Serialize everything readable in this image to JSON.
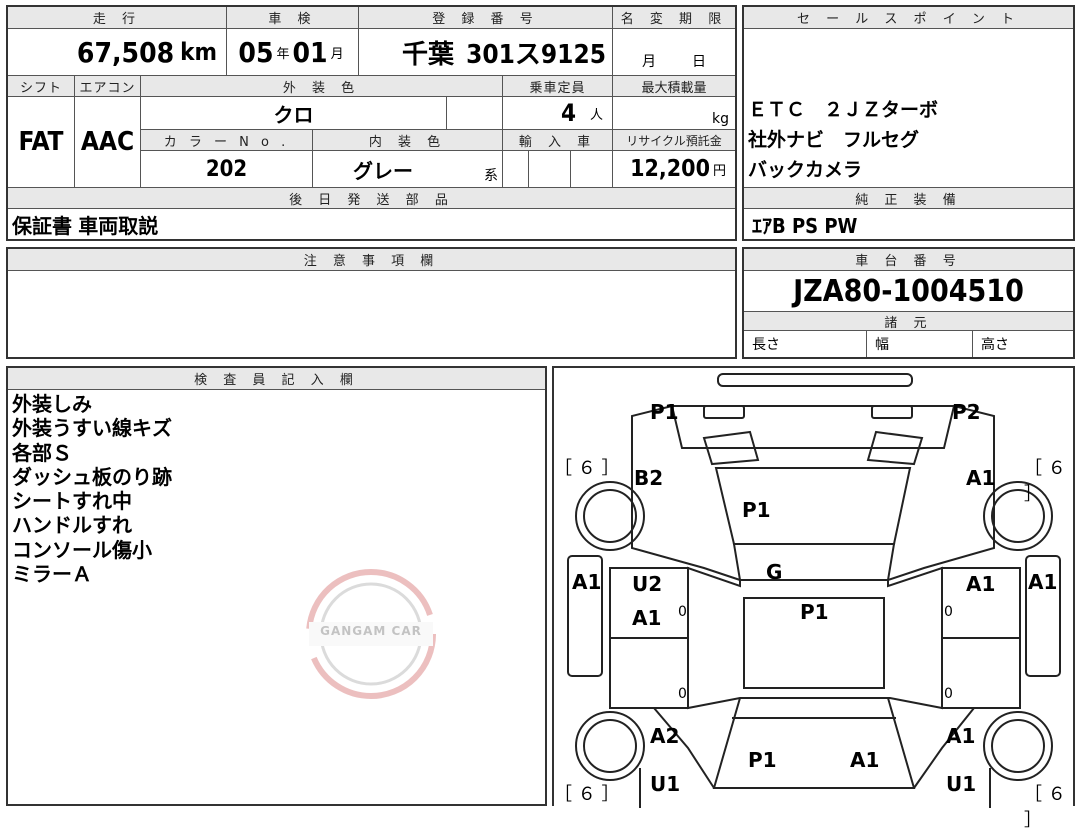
{
  "header": {
    "mileage_label": "走 行",
    "inspection_label": "車 検",
    "reg_label": "登 録 番 号",
    "name_change_label": "名 変 期 限",
    "sales_label": "セ ー ル ス ポ イ ン ト"
  },
  "row1": {
    "mileage": "67,508",
    "mileage_unit": "km",
    "inspection_year": "05",
    "year_unit": "年",
    "inspection_month": "01",
    "month_unit": "月",
    "reg_area": "千葉",
    "reg_number": "301ス9125",
    "name_month": "月",
    "name_day": "日"
  },
  "row2_labels": {
    "shift": "シフト",
    "aircon": "エアコン",
    "exterior_color": "外 装 色",
    "capacity": "乗車定員",
    "max_load": "最大積載量"
  },
  "row2": {
    "shift": "FAT",
    "aircon": "AAC",
    "exterior_color": "クロ",
    "capacity": "4",
    "capacity_unit": "人",
    "load_unit": "kg"
  },
  "row3_labels": {
    "color_no": "カ ラ ー N o .",
    "interior_color": "内 装 色",
    "import": "輸 入 車",
    "recycle": "リサイクル預託金"
  },
  "row3": {
    "color_no": "202",
    "interior_color": "グレー",
    "interior_suffix": "系",
    "recycle": "12,200",
    "recycle_unit": "円"
  },
  "sales_points": [
    "ＥＴＣ　２ＪＺターボ",
    "社外ナビ　フルセグ",
    "バックカメラ"
  ],
  "later_parts": {
    "label": "後 日 発 送 部 品",
    "value": "保証書 車両取説"
  },
  "genuine_equipment": {
    "label": "純 正 装 備",
    "value": "ｴｱB PS PW"
  },
  "notes": {
    "label": "注 意 事 項 欄"
  },
  "chassis": {
    "label": "車 台 番 号",
    "value": "JZA80-1004510",
    "spec_label": "諸 元",
    "length": "長さ",
    "width": "幅",
    "height": "高さ"
  },
  "inspector": {
    "label": "検 査 員 記 入 欄",
    "lines": [
      "外装しみ",
      "外装うすい線キズ",
      "各部Ｓ",
      "ダッシュ板のり跡",
      "シートすれ中",
      "ハンドルすれ",
      "コンソール傷小",
      "ミラーＡ"
    ]
  },
  "watermark": "GANGAM CAR",
  "diagram": {
    "bracket_label": "［ ６ ］",
    "marks": {
      "front_left": "P1",
      "front_right": "P2",
      "fender_front_left": "B2",
      "fender_front_right": "A1",
      "hood": "P1",
      "mirror_left": "A1",
      "mirror_right": "A1",
      "windshield": "G",
      "front_door_left_1": "U2",
      "front_door_left_2": "A1",
      "front_door_right": "A1",
      "roof": "P1",
      "rear_fender_left": "A2",
      "rear_fender_right": "A1",
      "trunk": "P1",
      "trunk_right": "A1",
      "rear_left": "U1",
      "rear_right": "U1",
      "zero": "0"
    }
  }
}
